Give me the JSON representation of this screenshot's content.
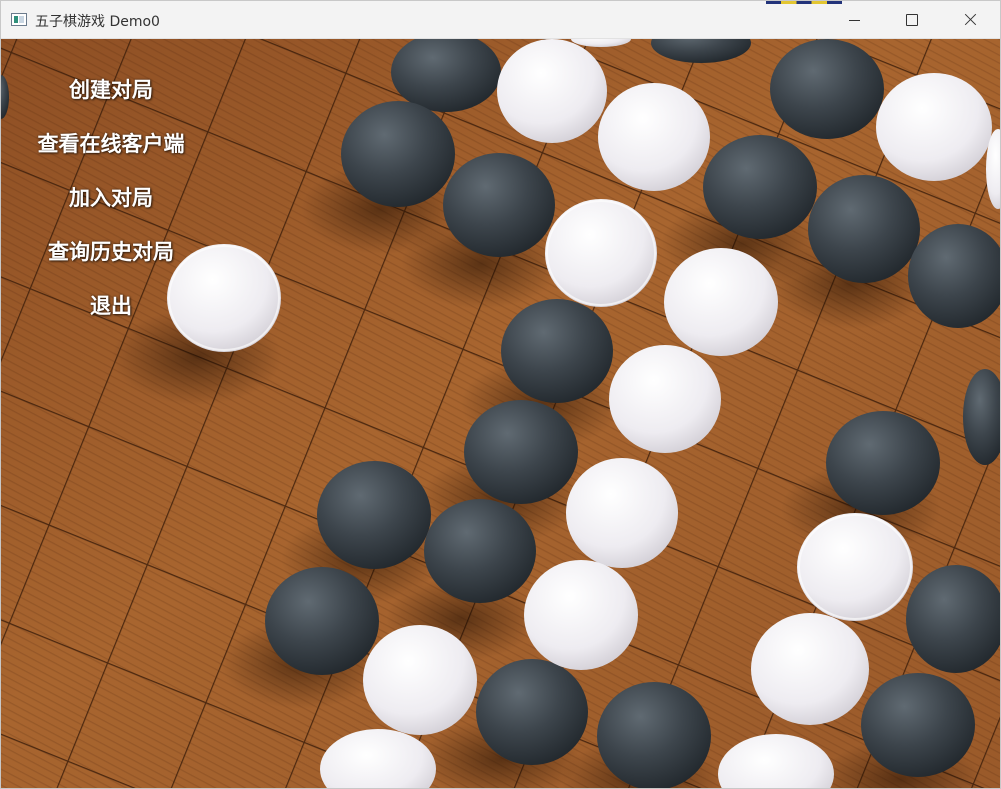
{
  "window": {
    "title": "五子棋游戏 Demo0"
  },
  "menu": {
    "items": [
      {
        "label": "创建对局"
      },
      {
        "label": "查看在线客户端"
      },
      {
        "label": "加入对局"
      },
      {
        "label": "查询历史对局"
      },
      {
        "label": "退出"
      }
    ]
  },
  "background": {
    "description_icon": "gomoku-board-with-stones",
    "board_color": "#9a5a2c",
    "black_stone_color": "#3a4148",
    "white_stone_color": "#f2f1f4"
  }
}
